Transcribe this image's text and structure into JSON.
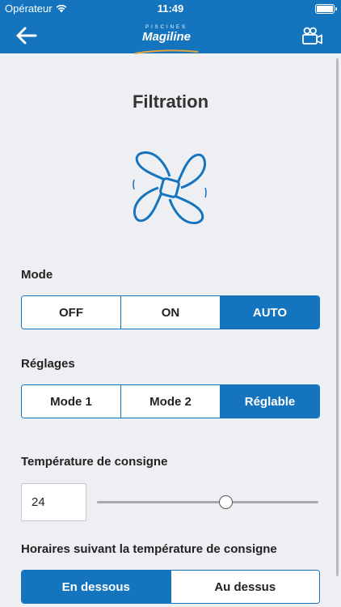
{
  "statusbar": {
    "carrier": "Opérateur",
    "time": "11:49"
  },
  "navbar": {
    "logo_small": "PISCINES",
    "logo_big": "Magiline",
    "back_icon": "arrow-left-icon",
    "camera_icon": "video-camera-icon"
  },
  "page": {
    "title": "Filtration",
    "icon": "fan-icon"
  },
  "mode": {
    "label": "Mode",
    "options": [
      "OFF",
      "ON",
      "AUTO"
    ],
    "selected": "AUTO"
  },
  "reglages": {
    "label": "Réglages",
    "options": [
      "Mode 1",
      "Mode 2",
      "Réglable"
    ],
    "selected": "Réglable"
  },
  "temperature": {
    "label": "Température de consigne",
    "value": "24",
    "slider_fraction": 0.58
  },
  "horaires": {
    "label": "Horaires suivant la température de consigne",
    "options": [
      "En dessous",
      "Au dessus"
    ],
    "selected": "En dessous"
  },
  "colors": {
    "accent": "#1474be",
    "background": "#eeeff3"
  }
}
